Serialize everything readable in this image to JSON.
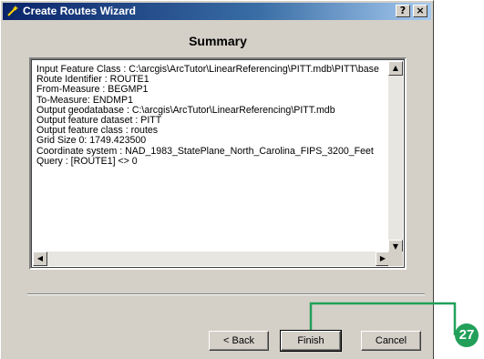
{
  "window": {
    "title": "Create Routes Wizard",
    "help_label": "?",
    "close_label": "×"
  },
  "heading": "Summary",
  "summary_lines": [
    "Input Feature Class : C:\\arcgis\\ArcTutor\\LinearReferencing\\PITT.mdb\\PITT\\base",
    "Route Identifier : ROUTE1",
    "From-Measure : BEGMP1",
    "To-Measure: ENDMP1",
    "Output geodatabase : C:\\arcgis\\ArcTutor\\LinearReferencing\\PITT.mdb",
    "Output feature dataset : PITT",
    "Output feature class : routes",
    "Grid Size 0: 1749.423500",
    "Coordinate system : NAD_1983_StatePlane_North_Carolina_FIPS_3200_Feet",
    "Query : [ROUTE1] <> 0"
  ],
  "buttons": {
    "back": "< Back",
    "finish": "Finish",
    "cancel": "Cancel"
  },
  "callout": {
    "number": "27",
    "color": "#22a05a"
  },
  "icons": {
    "title": "wizard-icon",
    "scroll_up": "arrow-up-icon",
    "scroll_down": "arrow-down-icon",
    "scroll_left": "arrow-left-icon",
    "scroll_right": "arrow-right-icon"
  }
}
